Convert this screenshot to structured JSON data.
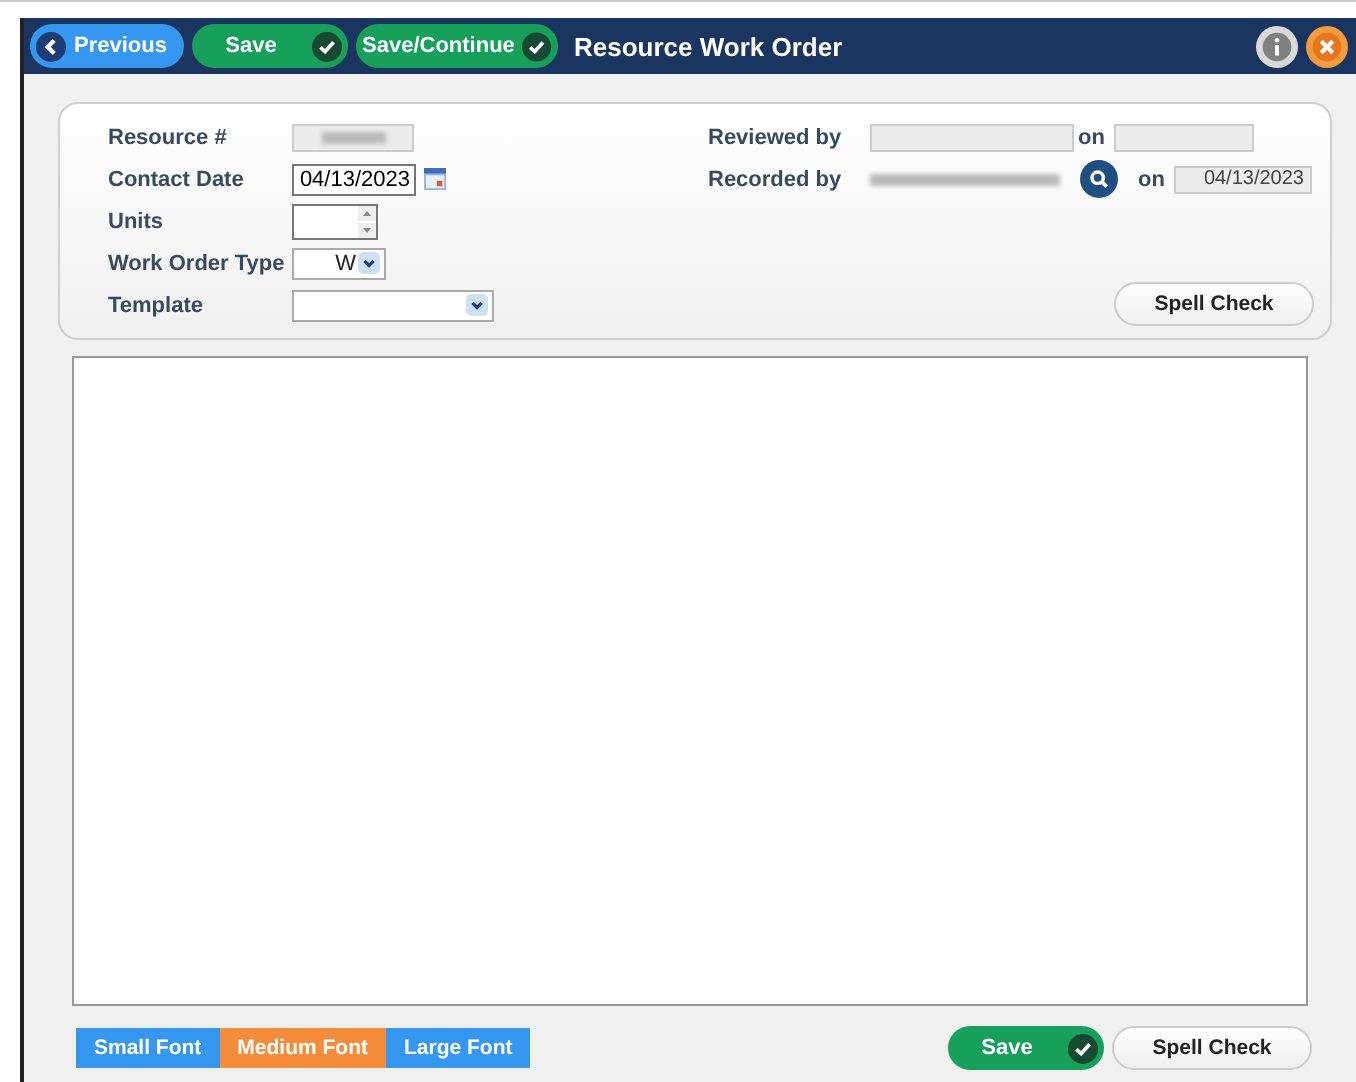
{
  "header": {
    "title": "Resource Work Order",
    "previous": "Previous",
    "save": "Save",
    "save_continue": "Save/Continue"
  },
  "form": {
    "resource_label": "Resource #",
    "contact_date_label": "Contact Date",
    "contact_date": "04/13/2023",
    "units_label": "Units",
    "work_order_type_label": "Work Order Type",
    "work_order_type": "W",
    "template_label": "Template",
    "reviewed_by_label": "Reviewed by",
    "reviewed_on_label": "on",
    "recorded_by_label": "Recorded by",
    "recorded_on_label": "on",
    "recorded_on": "04/13/2023",
    "spell_check": "Spell Check"
  },
  "font_buttons": [
    {
      "label": "Small Font",
      "selected": false
    },
    {
      "label": "Medium Font",
      "selected": true
    },
    {
      "label": "Large Font",
      "selected": false
    }
  ],
  "footer": {
    "save": "Save",
    "spell_check": "Spell Check"
  }
}
